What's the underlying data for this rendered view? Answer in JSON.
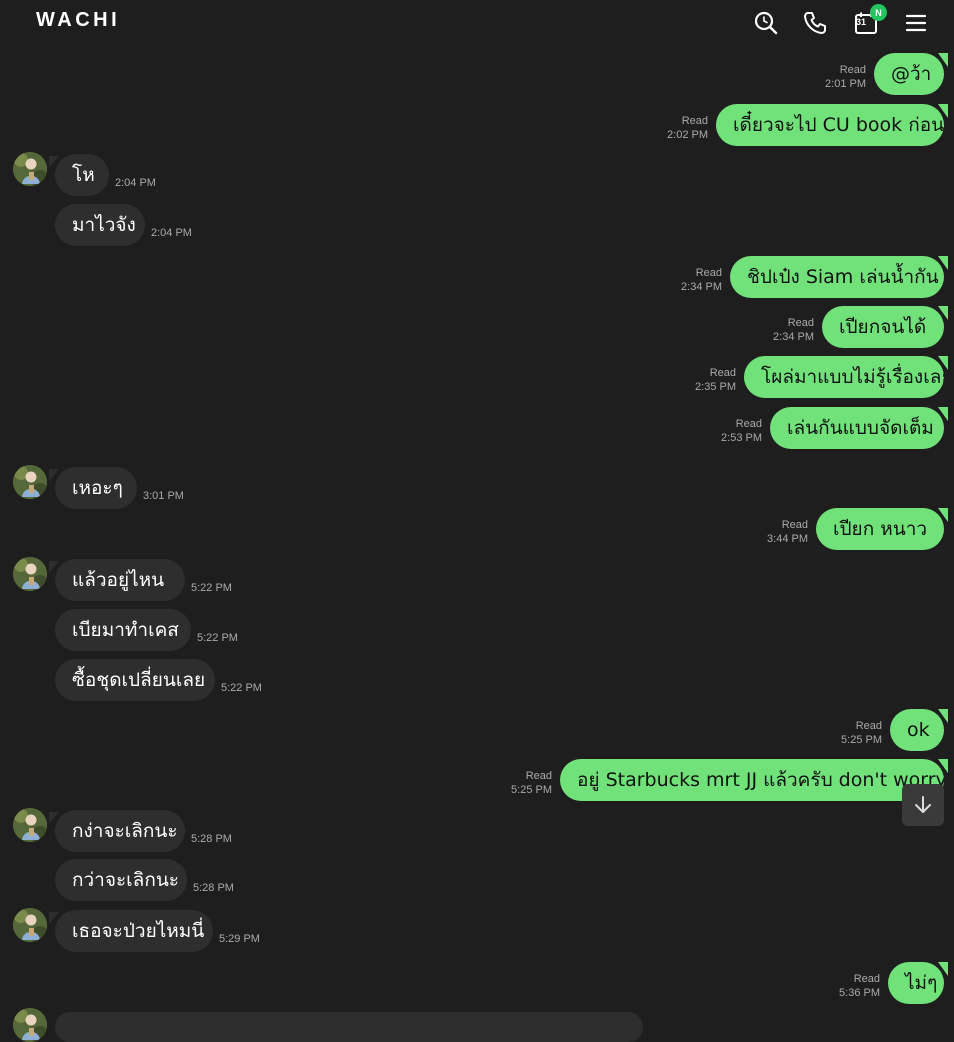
{
  "header": {
    "title": "WACHI",
    "calendar_day": "31",
    "calendar_badge": "N",
    "icons": [
      "search-icon",
      "phone-icon",
      "calendar-icon",
      "menu-icon"
    ]
  },
  "colors": {
    "background": "#1e1e1e",
    "sent_bubble": "#71e27a",
    "received_bubble": "#2e2e2e",
    "badge": "#22c55e"
  },
  "messages": [
    {
      "dir": "sent",
      "text": "@ว้า",
      "read": "Read",
      "time": "2:01 PM"
    },
    {
      "dir": "sent",
      "text": "เดี๋ยวจะไป CU book ก่อน",
      "read": "Read",
      "time": "2:02 PM"
    },
    {
      "dir": "recv",
      "text": "โห",
      "time": "2:04 PM",
      "avatar": true
    },
    {
      "dir": "recv",
      "text": "มาไวจัง",
      "time": "2:04 PM"
    },
    {
      "dir": "sent",
      "text": "ชิปเป๋ง  Siam เล่นน้ำกัน",
      "read": "Read",
      "time": "2:34 PM"
    },
    {
      "dir": "sent",
      "text": "เปียกจนได้",
      "read": "Read",
      "time": "2:34 PM"
    },
    {
      "dir": "sent",
      "text": "โผล่มาแบบไม่รู้เรื่องเลย",
      "read": "Read",
      "time": "2:35 PM"
    },
    {
      "dir": "sent",
      "text": "เล่นกันแบบจัดเต็ม",
      "read": "Read",
      "time": "2:53 PM"
    },
    {
      "dir": "recv",
      "text": "เหอะๆ",
      "time": "3:01 PM",
      "avatar": true
    },
    {
      "dir": "sent",
      "text": "เปียก  หนาว",
      "read": "Read",
      "time": "3:44 PM"
    },
    {
      "dir": "recv",
      "text": "แล้วอยู่ไหน",
      "time": "5:22 PM",
      "avatar": true
    },
    {
      "dir": "recv",
      "text": "เบียมาทำเคส",
      "time": "5:22 PM"
    },
    {
      "dir": "recv",
      "text": "ซื้อชุดเปลี่ยนเลย",
      "time": "5:22 PM"
    },
    {
      "dir": "sent",
      "text": "ok",
      "read": "Read",
      "time": "5:25 PM"
    },
    {
      "dir": "sent",
      "text": "อยู่ Starbucks mrt JJ แล้วครับ don't worry",
      "read": "Read",
      "time": "5:25 PM"
    },
    {
      "dir": "recv",
      "text": "กง่าจะเลิกนะ",
      "time": "5:28 PM",
      "avatar": true
    },
    {
      "dir": "recv",
      "text": "กว่าจะเลิกนะ",
      "time": "5:28 PM"
    },
    {
      "dir": "recv",
      "text": "เธอจะป่วยไหมนี่",
      "time": "5:29 PM",
      "avatar": true
    },
    {
      "dir": "sent",
      "text": "ไม่ๆ",
      "read": "Read",
      "time": "5:36 PM"
    }
  ]
}
